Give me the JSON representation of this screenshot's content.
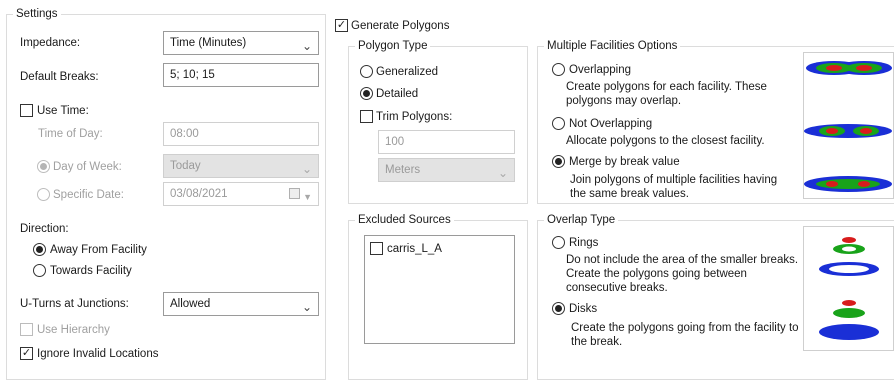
{
  "settings": {
    "legend": "Settings",
    "impedance": {
      "label": "Impedance:",
      "value": "Time (Minutes)"
    },
    "default_breaks": {
      "label": "Default Breaks:",
      "value": "5; 10; 15"
    },
    "use_time": {
      "label": "Use Time:",
      "checked": false
    },
    "time_of_day": {
      "label": "Time of Day:",
      "value": "08:00"
    },
    "day_of_week": {
      "label": "Day of Week:",
      "value": "Today",
      "selected": true
    },
    "specific_date": {
      "label": "Specific Date:",
      "value": "03/08/2021",
      "selected": false
    },
    "direction": {
      "label": "Direction:",
      "options": [
        "Away From Facility",
        "Towards Facility"
      ],
      "selected": "Away From Facility"
    },
    "u_turns": {
      "label": "U-Turns at Junctions:",
      "value": "Allowed"
    },
    "use_hierarchy": {
      "label": "Use Hierarchy",
      "checked": false
    },
    "ignore_invalid": {
      "label": "Ignore Invalid Locations",
      "checked": true
    }
  },
  "generate_polygons": {
    "label": "Generate Polygons",
    "checked": true
  },
  "polygon_type": {
    "legend": "Polygon Type",
    "options": [
      "Generalized",
      "Detailed"
    ],
    "selected": "Detailed",
    "trim_polygons": {
      "label": "Trim Polygons:",
      "checked": false
    },
    "trim_distance": "100",
    "trim_units": "Meters"
  },
  "multiple_facilities": {
    "legend": "Multiple Facilities Options",
    "options": [
      {
        "label": "Overlapping",
        "description": "Create polygons for each facility. These polygons may overlap."
      },
      {
        "label": "Not Overlapping",
        "description": "Allocate polygons to the closest facility."
      },
      {
        "label": "Merge by break value",
        "description": "Join polygons of multiple facilities having the same break values."
      }
    ],
    "selected": "Merge by break value"
  },
  "excluded_sources": {
    "legend": "Excluded Sources",
    "items": [
      {
        "label": "carris_L_A",
        "checked": false
      }
    ]
  },
  "overlap_type": {
    "legend": "Overlap Type",
    "options": [
      {
        "label": "Rings",
        "description": "Do not include the area of the smaller breaks. Create the polygons going between consecutive breaks."
      },
      {
        "label": "Disks",
        "description": "Create the polygons going from the facility to the break."
      }
    ],
    "selected": "Disks"
  },
  "colors": {
    "ring_outer": "#1a2fd6",
    "ring_middle": "#19a31a",
    "ring_inner": "#d81c1c"
  },
  "icons": {
    "chevron": "chevron-down-icon",
    "check": "checkmark-icon",
    "calendar": "calendar-icon"
  }
}
